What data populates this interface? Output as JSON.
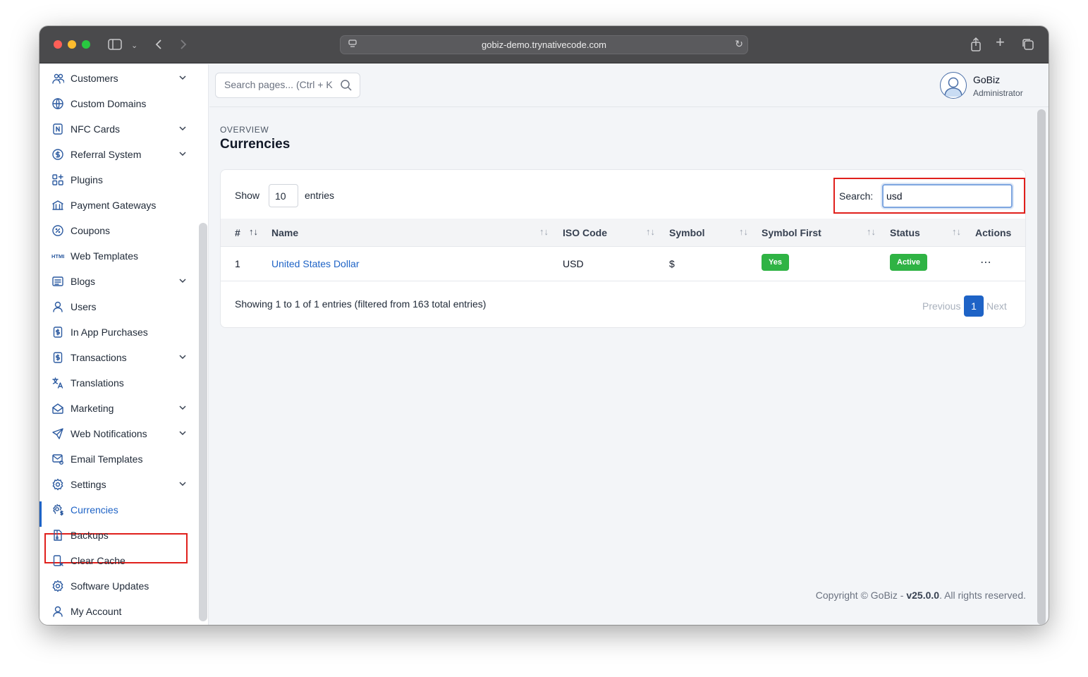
{
  "browser": {
    "url": "gobiz-demo.trynativecode.com"
  },
  "sidebar": {
    "items": [
      {
        "label": "Customers",
        "icon": "users-group-icon",
        "chevron": true
      },
      {
        "label": "Custom Domains",
        "icon": "www-globe-icon",
        "chevron": false
      },
      {
        "label": "NFC Cards",
        "icon": "nfc-icon",
        "chevron": true
      },
      {
        "label": "Referral System",
        "icon": "dollar-circle-icon",
        "chevron": true
      },
      {
        "label": "Plugins",
        "icon": "plugins-grid-icon",
        "chevron": false
      },
      {
        "label": "Payment Gateways",
        "icon": "bank-icon",
        "chevron": false
      },
      {
        "label": "Coupons",
        "icon": "discount-icon",
        "chevron": false
      },
      {
        "label": "Web Templates",
        "icon": "html-icon",
        "chevron": false
      },
      {
        "label": "Blogs",
        "icon": "article-icon",
        "chevron": true
      },
      {
        "label": "Users",
        "icon": "user-icon",
        "chevron": false
      },
      {
        "label": "In App Purchases",
        "icon": "receipt-dollar-icon",
        "chevron": false
      },
      {
        "label": "Transactions",
        "icon": "receipt-dollar-icon",
        "chevron": true
      },
      {
        "label": "Translations",
        "icon": "language-icon",
        "chevron": false
      },
      {
        "label": "Marketing",
        "icon": "mail-open-icon",
        "chevron": true
      },
      {
        "label": "Web Notifications",
        "icon": "send-icon",
        "chevron": true
      },
      {
        "label": "Email Templates",
        "icon": "mail-cog-icon",
        "chevron": false
      },
      {
        "label": "Settings",
        "icon": "gear-icon",
        "chevron": true
      },
      {
        "label": "Currencies",
        "icon": "gear-dollar-icon",
        "chevron": false,
        "active": true
      },
      {
        "label": "Backups",
        "icon": "file-zip-icon",
        "chevron": false
      },
      {
        "label": "Clear Cache",
        "icon": "device-x-icon",
        "chevron": false
      },
      {
        "label": "Software Updates",
        "icon": "gear-refresh-icon",
        "chevron": false
      },
      {
        "label": "My Account",
        "icon": "user-icon",
        "chevron": false
      }
    ]
  },
  "topbar": {
    "search_placeholder": "Search pages... (Ctrl + K",
    "user_name": "GoBiz",
    "user_role": "Administrator"
  },
  "page": {
    "overline": "OVERVIEW",
    "title": "Currencies"
  },
  "table_controls": {
    "show_label": "Show",
    "entries_value": "10",
    "entries_label": "entries",
    "search_label": "Search:",
    "search_value": "usd"
  },
  "table": {
    "columns": [
      "#",
      "Name",
      "ISO Code",
      "Symbol",
      "Symbol First",
      "Status",
      "Actions"
    ],
    "rows": [
      {
        "num": "1",
        "name": "United States Dollar",
        "iso": "USD",
        "symbol": "$",
        "symbol_first": "Yes",
        "status": "Active",
        "actions": "..."
      }
    ]
  },
  "pagination": {
    "info": "Showing 1 to 1 of 1 entries (filtered from 163 total entries)",
    "previous": "Previous",
    "current": "1",
    "next": "Next"
  },
  "footer": {
    "prefix": "Copyright © GoBiz - ",
    "version": "v25.0.0",
    "suffix": ". All rights reserved."
  },
  "colors": {
    "accent": "#1e63c6",
    "success": "#2fb344",
    "highlight": "#e0201c"
  }
}
